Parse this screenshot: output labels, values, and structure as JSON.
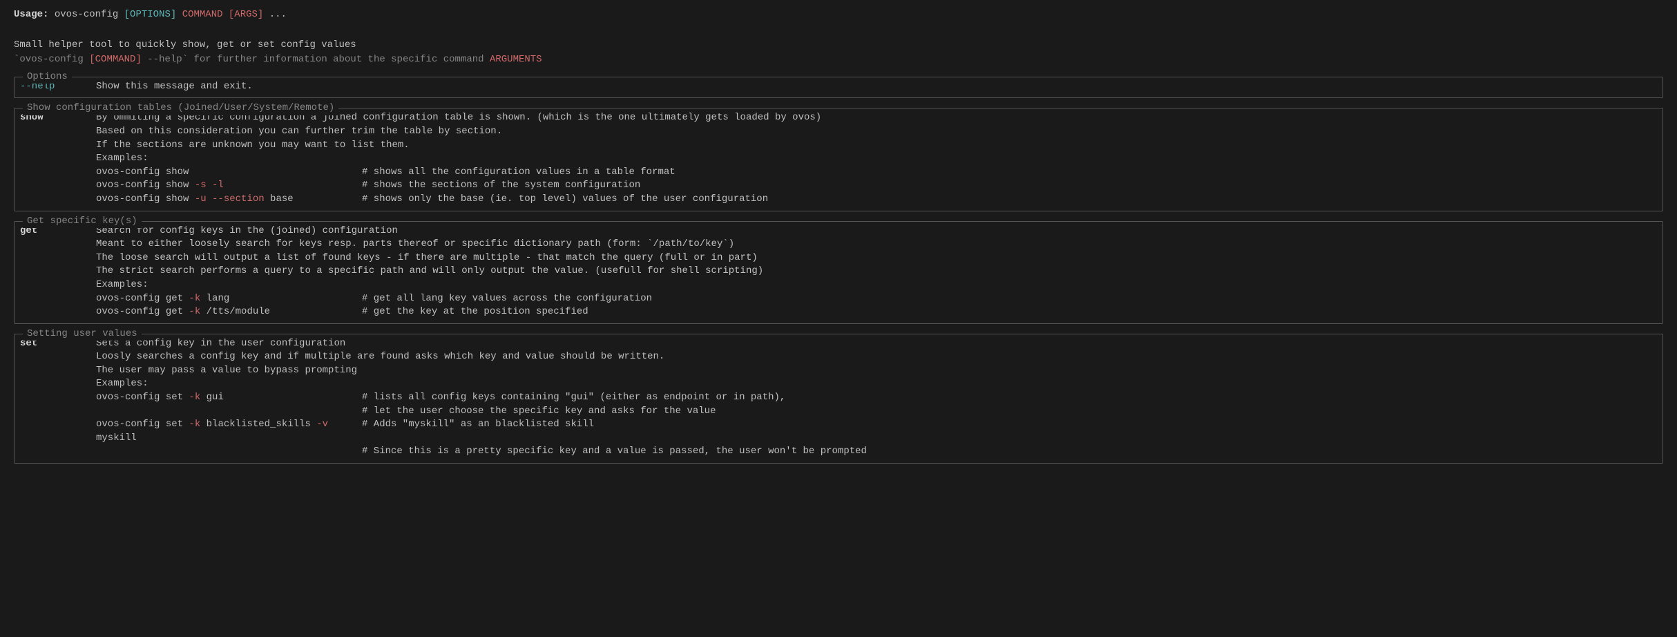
{
  "usage": {
    "label": "Usage:",
    "cmd": "ovos-config",
    "options": "[OPTIONS]",
    "command": "COMMAND",
    "args": "[ARGS]",
    "ellipsis": "..."
  },
  "description": {
    "line1": "Small helper tool to quickly show, get or set config values",
    "backtick1": "`",
    "cmd": "ovos-config",
    "command": "[COMMAND]",
    "help": "--help",
    "backtick2": "`",
    "rest": " for further information about the specific command ",
    "arguments": "ARGUMENTS"
  },
  "options": {
    "title": "Options",
    "help_flag": "--help",
    "help_desc": "Show this message and exit."
  },
  "show_section": {
    "title": "Show configuration tables (Joined/User/System/Remote)",
    "cmd": "show",
    "line1": "By ommiting a specific configuration a joined configuration table is shown. (which is the one ultimately gets loaded by ovos)",
    "line2": "Based on this consideration you can further trim the table by section.",
    "line3": "If the sections are unknown you may want to list them.",
    "examples_label": "Examples:",
    "ex1_cmd": "ovos-config show",
    "ex1_comment": "# shows all the configuration values in a table format",
    "ex2_prefix": "ovos-config show ",
    "ex2_flags": "-s -l",
    "ex2_comment": "# shows the sections of the system configuration",
    "ex3_prefix": "ovos-config show ",
    "ex3_flags": "-u --section",
    "ex3_suffix": " base",
    "ex3_comment": "# shows only the base (ie. top level) values of the user configuration"
  },
  "get_section": {
    "title": "Get specific key(s)",
    "cmd": "get",
    "line1": "Search for config keys in the (joined) configuration",
    "line2": "Meant to either loosely search for keys resp. parts thereof or specific dictionary path (form: `/path/to/key`)",
    "line3": "The loose search will output a list of found keys - if there are multiple - that match the query (full or in part)",
    "line4": "The strict search performs a query to a specific path and will only output the value. (usefull for shell scripting)",
    "examples_label": "Examples:",
    "ex1_prefix": "ovos-config get ",
    "ex1_flags": "-k",
    "ex1_suffix": " lang",
    "ex1_comment": "# get all lang key values across the configuration",
    "ex2_prefix": "ovos-config get ",
    "ex2_flags": "-k",
    "ex2_suffix": " /tts/module",
    "ex2_comment": "# get the key at the position specified"
  },
  "set_section": {
    "title": "Setting user values",
    "cmd": "set",
    "line1": "Sets a config key in the user configuration",
    "line2": "Loosly searches a config key and if multiple are found asks which key and value should be written.",
    "line3": "The user may pass a value to bypass prompting",
    "examples_label": "Examples:",
    "ex1_prefix": "ovos-config set ",
    "ex1_flags": "-k",
    "ex1_suffix": " gui",
    "ex1_comment": "# lists all config keys containing \"gui\" (either as endpoint or in path),",
    "ex1_comment2": "# let the user choose the specific key and asks for the value",
    "ex2_prefix": "ovos-config set ",
    "ex2_flags1": "-k",
    "ex2_mid": " blacklisted_skills ",
    "ex2_flags2": "-v",
    "ex2_suffix": " myskill",
    "ex2_comment": "# Adds \"myskill\" as an blacklisted skill",
    "ex2_comment2": "# Since this is a pretty specific key and a value is passed, the user won't be prompted"
  }
}
